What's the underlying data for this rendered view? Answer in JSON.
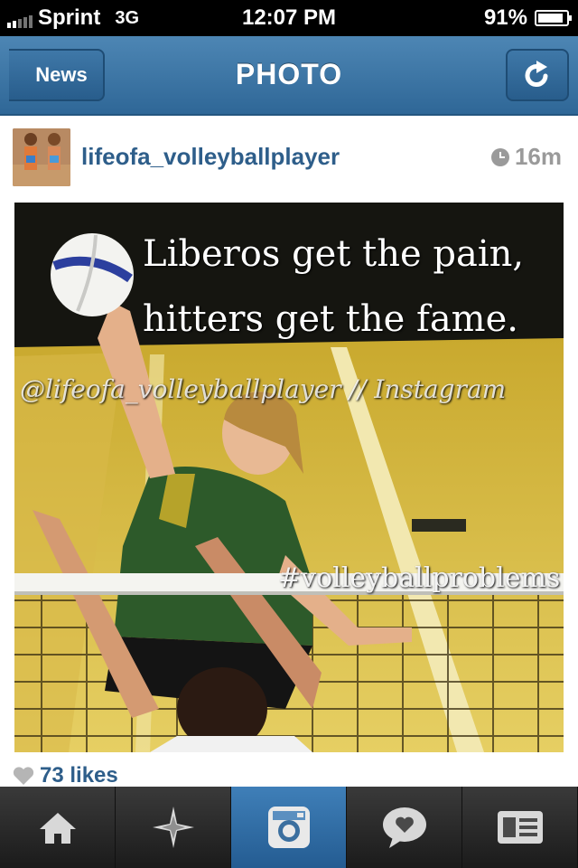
{
  "status_bar": {
    "carrier": "Sprint",
    "network": "3G",
    "time": "12:07 PM",
    "battery": "91%",
    "battery_level": 0.91
  },
  "nav": {
    "back_label": "News",
    "title": "PHOTO",
    "refresh_icon": "refresh-icon"
  },
  "post": {
    "username": "lifeofa_volleyballplayer",
    "time_ago": "16m",
    "caption_line1": "Liberos get the pain,",
    "caption_line2": "hitters get the fame.",
    "watermark": "@lifeofa_volleyballplayer // Instagram",
    "hashtag": "#volleyballproblems",
    "likes": "73 likes"
  },
  "tabs": [
    {
      "icon": "home-icon"
    },
    {
      "icon": "explore-icon"
    },
    {
      "icon": "camera-icon",
      "active": true
    },
    {
      "icon": "activity-icon"
    },
    {
      "icon": "profile-icon"
    }
  ],
  "colors": {
    "nav_blue": "#3f78a8",
    "link_blue": "#2e5e8a",
    "tab_active": "#2f6fa7"
  }
}
